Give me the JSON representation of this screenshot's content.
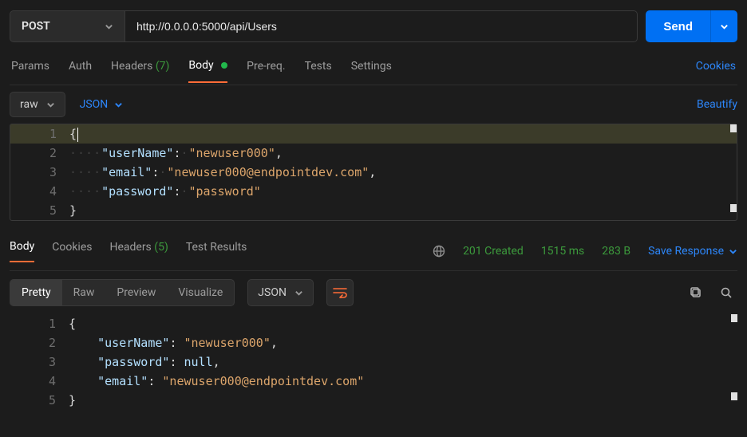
{
  "request": {
    "method": "POST",
    "url": "http://0.0.0.0:5000/api/Users",
    "send_label": "Send"
  },
  "tabs": {
    "params": "Params",
    "auth": "Auth",
    "headers": "Headers",
    "headers_count": "(7)",
    "body": "Body",
    "prereq": "Pre-req.",
    "tests": "Tests",
    "settings": "Settings",
    "cookies_link": "Cookies"
  },
  "body_bar": {
    "raw": "raw",
    "json": "JSON",
    "beautify": "Beautify"
  },
  "request_body_lines": {
    "l1": "{",
    "l2_key": "\"userName\"",
    "l2_val": "\"newuser000\"",
    "l3_key": "\"email\"",
    "l3_val": "\"newuser000@endpointdev.com\"",
    "l4_key": "\"password\"",
    "l4_val": "\"password\"",
    "l5": "}",
    "gutter": {
      "1": "1",
      "2": "2",
      "3": "3",
      "4": "4",
      "5": "5"
    }
  },
  "response_tabs": {
    "body": "Body",
    "cookies": "Cookies",
    "headers": "Headers",
    "headers_count": "(5)",
    "tests": "Test Results"
  },
  "response_meta": {
    "status": "201 Created",
    "time": "1515 ms",
    "size": "283 B",
    "save": "Save Response"
  },
  "response_toolbar": {
    "pretty": "Pretty",
    "raw": "Raw",
    "preview": "Preview",
    "visualize": "Visualize",
    "json": "JSON"
  },
  "response_body_lines": {
    "l1": "{",
    "l2_key": "\"userName\"",
    "l2_val": "\"newuser000\"",
    "l3_key": "\"password\"",
    "l3_val": "null",
    "l4_key": "\"email\"",
    "l4_val": "\"newuser000@endpointdev.com\"",
    "l5": "}",
    "gutter": {
      "1": "1",
      "2": "2",
      "3": "3",
      "4": "4",
      "5": "5"
    }
  }
}
